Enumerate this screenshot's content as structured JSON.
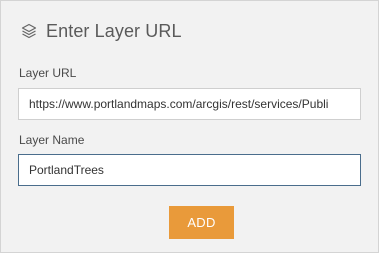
{
  "header": {
    "icon": "layers-icon",
    "title": "Enter Layer URL"
  },
  "form": {
    "url_label": "Layer URL",
    "url_value": "https://www.portlandmaps.com/arcgis/rest/services/Publi",
    "name_label": "Layer Name",
    "name_value": "PortlandTrees"
  },
  "actions": {
    "add_label": "ADD",
    "add_color": "#e99a3a"
  }
}
